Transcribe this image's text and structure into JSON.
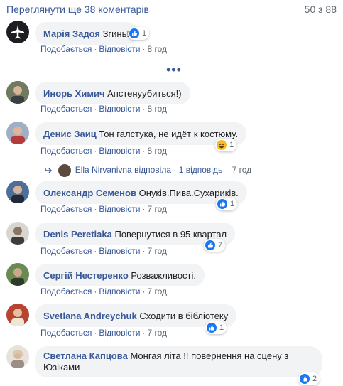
{
  "header": {
    "more_comments": "Переглянути ще 38 коментарів",
    "count": "50 з 88"
  },
  "actions": {
    "like": "Подобається",
    "reply": "Відповісти",
    "dot": "·"
  },
  "colors": {
    "link": "#385898",
    "bubble": "#f2f3f5",
    "like_blue": "#1877f2",
    "haha_yellow": "#f7b928"
  },
  "comments": [
    {
      "author": "Марія Задоя",
      "text": "Згинь!",
      "time": "8 год",
      "reaction_icon": "like-icon",
      "reaction_count": "1"
    },
    {
      "author": "Инорь Химич",
      "text": "Апстенуубиться!)",
      "time": "8 год"
    },
    {
      "author": "Денис Заиц",
      "text": "Тон галстука, не идёт к костюму.",
      "time": "8 год",
      "reaction_icon": "haha-icon",
      "reaction_count": "1"
    },
    {
      "author": "Олександр Семенов",
      "text": "Онуків.Пива.Сухариків.",
      "time": "7 год",
      "reaction_icon": "like-icon",
      "reaction_count": "1"
    },
    {
      "author": "Denis Peretiaka",
      "text": "Повернутися в 95 квартал",
      "time": "7 год",
      "reaction_icon": "like-icon",
      "reaction_count": "7"
    },
    {
      "author": "Сергій Нестеренко",
      "text": "Розважливості.",
      "time": "7 год"
    },
    {
      "author": "Svetlana Andreychuk",
      "text": "Сходити в бібліотеку",
      "time": "7 год",
      "reaction_icon": "like-icon",
      "reaction_count": "1"
    },
    {
      "author": "Светлана Капцова",
      "text": "Монгая літа !! повернення на сцену з Юзіками",
      "reaction_icon": "like-icon",
      "reaction_count": "2"
    }
  ],
  "reply_thread": {
    "name": "Ella Nirvanivna",
    "replied": "відповіла",
    "count": "1 відповідь",
    "time": "7 год"
  }
}
